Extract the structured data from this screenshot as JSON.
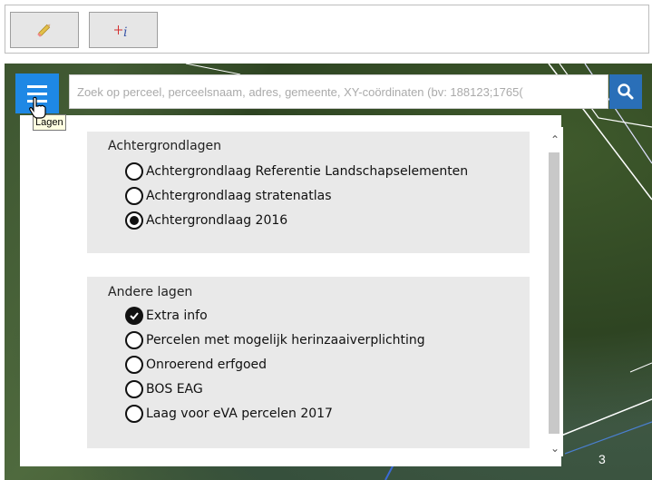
{
  "toolbar": {
    "tools": [
      {
        "name": "pencil-icon",
        "label": ""
      },
      {
        "name": "measure-info-icon",
        "label": ""
      }
    ]
  },
  "search": {
    "placeholder": "Zoek op perceel, perceelsnaam, adres, gemeente, XY-coördinaten (bv: 188123;1765("
  },
  "menu": {
    "tooltip": "Lagen"
  },
  "panel": {
    "background_layers": {
      "title": "Achtergrondlagen",
      "options": [
        {
          "label": "Achtergrondlaag Referentie Landschapselementen",
          "selected": false
        },
        {
          "label": "Achtergrondlaag stratenatlas",
          "selected": false
        },
        {
          "label": "Achtergrondlaag 2016",
          "selected": true
        }
      ]
    },
    "other_layers": {
      "title": "Andere lagen",
      "options": [
        {
          "label": "Extra info",
          "checked": true
        },
        {
          "label": "Percelen met mogelijk herinzaaiverplichting",
          "checked": false
        },
        {
          "label": "Onroerend erfgoed",
          "checked": false
        },
        {
          "label": "BOS EAG",
          "checked": false
        },
        {
          "label": "Laag voor eVA percelen 2017",
          "checked": false
        }
      ]
    }
  },
  "map": {
    "parcel_label": "3"
  },
  "colors": {
    "accent": "#1e88e5",
    "search_button": "#2a6fb8",
    "group_bg": "#e9e9e9"
  }
}
